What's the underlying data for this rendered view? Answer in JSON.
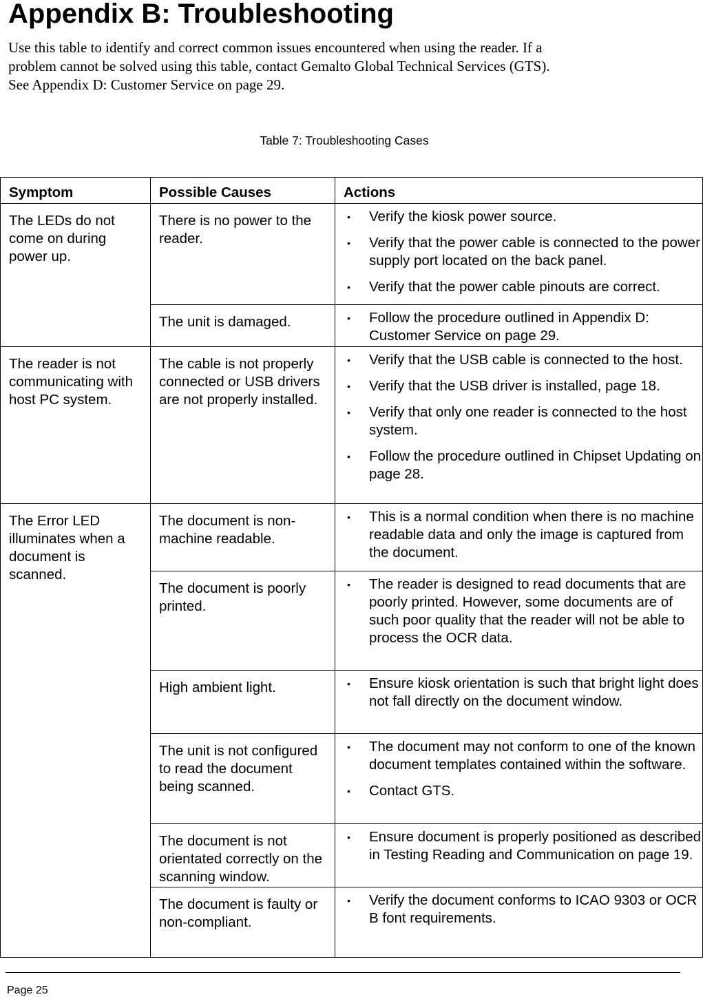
{
  "heading": "Appendix B: Troubleshooting",
  "intro": {
    "lines": [
      "Use this table to identify and correct common issues encountered when using the reader. If a",
      "problem cannot be solved using this table, contact Gemalto Global Technical Services (GTS).",
      "See Appendix D: Customer Service on page 29."
    ]
  },
  "table": {
    "caption": "Table 7: Troubleshooting Cases",
    "headers": [
      "Symptom",
      "Possible Causes",
      "Actions"
    ],
    "symptoms": [
      {
        "symptom": "The LEDs do not come on during power up.",
        "causes": [
          {
            "cause": "There is no power to the reader.",
            "actions": [
              "Verify the kiosk power source.",
              "Verify that the power cable is connected to the power supply port located on the back panel.",
              "Verify that the power cable pinouts are correct."
            ]
          },
          {
            "cause": "The unit is damaged.",
            "actions": [
              "Follow the procedure outlined in Appendix D: Customer Service on page 29."
            ]
          }
        ]
      },
      {
        "symptom": "The reader is not communicating with host PC system.",
        "causes": [
          {
            "cause": "The cable is not properly connected or USB drivers are not properly installed.",
            "actions": [
              "Verify that the USB cable is connected to the host.",
              "Verify that the USB driver is installed, page 18.",
              "Verify that only one reader is connected to the host system.",
              "Follow the procedure outlined in Chipset Updating on page 28."
            ]
          }
        ]
      },
      {
        "symptom": "The Error LED illuminates when a document is scanned.",
        "causes": [
          {
            "cause": "The document is non-machine readable.",
            "actions": [
              "This is a normal condition when there is no machine readable data and only the image is captured from the document."
            ]
          },
          {
            "cause": "The document is poorly printed.",
            "actions": [
              "The reader is designed to read documents that are poorly printed. However, some documents are of such poor quality that the reader will not be able to process the OCR data."
            ]
          },
          {
            "cause": "High ambient light.",
            "actions": [
              "Ensure kiosk orientation is such that bright light does not fall directly on the document window."
            ]
          },
          {
            "cause": "The unit is not configured to read the document being scanned.",
            "actions": [
              "The document may not conform to one of the known document templates contained within the software.",
              "Contact GTS."
            ]
          },
          {
            "cause": "The document is not orientated correctly on the scanning window.",
            "actions": [
              "Ensure document is properly positioned as described in Testing Reading and Communication on page 19."
            ]
          },
          {
            "cause": "The document is faulty or non-compliant.",
            "actions": [
              "Verify the document conforms to ICAO 9303 or OCR B font requirements."
            ]
          }
        ]
      }
    ]
  },
  "footer": {
    "page_label": "Page 25"
  },
  "icons": {
    "bullet": "•"
  }
}
